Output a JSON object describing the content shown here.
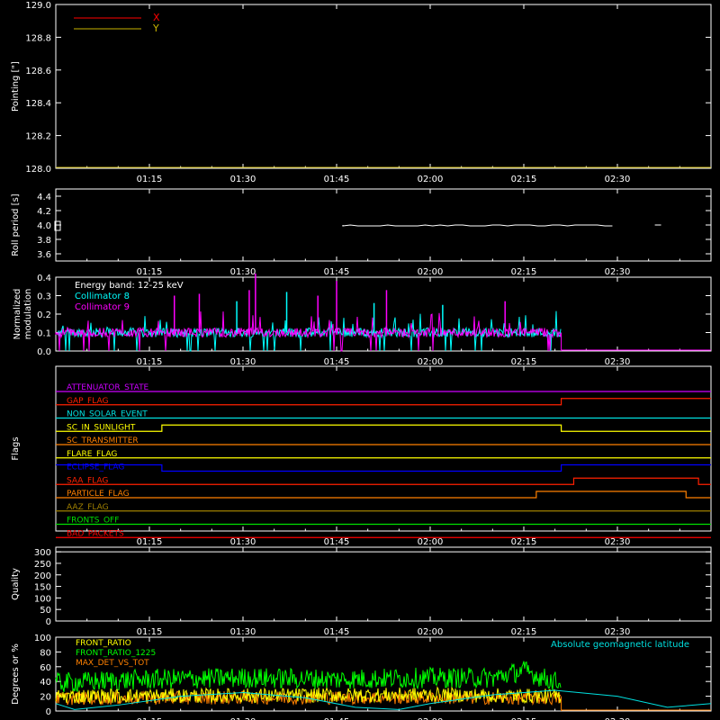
{
  "time_axis": {
    "start": "01:00",
    "end": "02:45",
    "ticks": [
      "01:15",
      "01:30",
      "01:45",
      "02:00",
      "02:15",
      "02:30"
    ]
  },
  "chart_data": [
    {
      "id": "pointing",
      "type": "line",
      "ylabel": "Pointing [\"]",
      "ylim": [
        128.0,
        129.0
      ],
      "yticks": [
        "128.0",
        "128.2",
        "128.4",
        "128.6",
        "128.8",
        "129.0"
      ],
      "legend": [
        {
          "name": "X",
          "color": "#ff0000"
        },
        {
          "name": "Y",
          "color": "#c8b400"
        }
      ],
      "series": []
    },
    {
      "id": "roll",
      "type": "line",
      "ylabel": "Roll period [s]",
      "ylim": [
        3.5,
        4.5
      ],
      "yticks": [
        "3.6",
        "3.8",
        "4.0",
        "4.2",
        "4.4"
      ],
      "series": [
        {
          "color": "#ffffff",
          "x": [
            "01:46",
            "02:02",
            "02:22",
            "02:27",
            "02:36"
          ],
          "values": [
            4.0,
            4.0,
            4.0,
            4.0,
            4.0
          ]
        }
      ]
    },
    {
      "id": "modulation",
      "type": "line",
      "ylabel": "Normalized modulation",
      "ylim": [
        0.0,
        0.4
      ],
      "yticks": [
        "0.0",
        "0.1",
        "0.2",
        "0.3",
        "0.4"
      ],
      "annotation": "Energy band: 12-25 keV",
      "series": [
        {
          "name": "Collimator 8",
          "color": "#00ffff"
        },
        {
          "name": "Collimator 9",
          "color": "#ff00ff"
        }
      ],
      "data_until": "02:21",
      "typical_value": 0.1,
      "spikes": [
        {
          "x": "01:32",
          "y": 0.42,
          "series": 1
        },
        {
          "x": "01:31",
          "y": 0.33,
          "series": 1
        },
        {
          "x": "01:23",
          "y": 0.31,
          "series": 1
        },
        {
          "x": "01:19",
          "y": 0.3,
          "series": 1
        },
        {
          "x": "01:45",
          "y": 0.38,
          "series": 1
        },
        {
          "x": "01:42",
          "y": 0.3,
          "series": 1
        },
        {
          "x": "01:53",
          "y": 0.33,
          "series": 1
        },
        {
          "x": "02:12",
          "y": 0.27,
          "series": 1
        },
        {
          "x": "01:37",
          "y": 0.32,
          "series": 0
        },
        {
          "x": "01:29",
          "y": 0.27,
          "series": 0
        },
        {
          "x": "01:51",
          "y": 0.26,
          "series": 0
        },
        {
          "x": "02:02",
          "y": 0.25,
          "series": 0
        }
      ]
    },
    {
      "id": "flags",
      "type": "line",
      "ylabel": "Flags",
      "flags": [
        {
          "name": "ATTENUATOR_STATE",
          "color": "#cc00ff",
          "steps": [
            [
              "01:00",
              0
            ]
          ]
        },
        {
          "name": "GAP_FLAG",
          "color": "#ff2000",
          "steps": [
            [
              "01:00",
              0
            ],
            [
              "02:21",
              1
            ]
          ]
        },
        {
          "name": "NON_SOLAR_EVENT",
          "color": "#00e0e0",
          "steps": [
            [
              "01:00",
              0
            ]
          ]
        },
        {
          "name": "SC_IN_SUNLIGHT",
          "color": "#ffff00",
          "steps": [
            [
              "01:00",
              0
            ],
            [
              "01:17",
              1
            ],
            [
              "02:21",
              0
            ]
          ]
        },
        {
          "name": "SC_TRANSMITTER",
          "color": "#ff8000",
          "steps": [
            [
              "01:00",
              0
            ]
          ]
        },
        {
          "name": "FLARE_FLAG",
          "color": "#ffff00",
          "steps": [
            [
              "01:00",
              0
            ]
          ]
        },
        {
          "name": "ECLIPSE_FLAG",
          "color": "#0000ff",
          "steps": [
            [
              "01:00",
              1
            ],
            [
              "01:17",
              0
            ],
            [
              "02:21",
              1
            ]
          ]
        },
        {
          "name": "SAA_FLAG",
          "color": "#ff2000",
          "steps": [
            [
              "01:00",
              0
            ],
            [
              "02:23",
              1
            ],
            [
              "02:43",
              0
            ]
          ]
        },
        {
          "name": "PARTICLE_FLAG",
          "color": "#ff8000",
          "steps": [
            [
              "01:00",
              0
            ],
            [
              "02:17",
              1
            ],
            [
              "02:41",
              0
            ]
          ]
        },
        {
          "name": "AAZ_FLAG",
          "color": "#a08000",
          "steps": [
            [
              "01:00",
              0
            ]
          ]
        },
        {
          "name": "FRONTS_OFF",
          "color": "#00e000",
          "steps": [
            [
              "01:00",
              0
            ]
          ]
        },
        {
          "name": "BAD_PACKETS",
          "color": "#ff0000",
          "steps": [
            [
              "01:00",
              0
            ]
          ]
        }
      ]
    },
    {
      "id": "quality",
      "type": "line",
      "ylabel": "Quality",
      "ylim": [
        0,
        320
      ],
      "yticks": [
        "0",
        "50",
        "100",
        "150",
        "200",
        "250",
        "300"
      ],
      "series": [
        {
          "color": "#ffffff",
          "x": [
            "01:00",
            "02:45"
          ],
          "values": [
            300,
            300
          ]
        }
      ]
    },
    {
      "id": "ratios",
      "type": "line",
      "ylabel": "Degrees or %",
      "ylim": [
        0,
        100
      ],
      "yticks": [
        "0",
        "20",
        "40",
        "60",
        "80",
        "100"
      ],
      "annotation": "Absolute geomagnetic latitude",
      "data_until": "02:21",
      "series": [
        {
          "name": "FRONT_RATIO",
          "color": "#ffff00",
          "x": [
            "01:00",
            "01:30",
            "02:00",
            "02:21"
          ],
          "values": [
            20,
            21,
            22,
            20
          ]
        },
        {
          "name": "FRONT_RATIO_1225",
          "color": "#00ff00",
          "x": [
            "01:00",
            "01:15",
            "01:30",
            "01:45",
            "02:00",
            "02:10",
            "02:15",
            "02:18",
            "02:21"
          ],
          "values": [
            38,
            43,
            45,
            43,
            45,
            45,
            55,
            45,
            38
          ]
        },
        {
          "name": "MAX_DET_VS_TOT",
          "color": "#ff8000",
          "x": [
            "01:00",
            "01:30",
            "02:00",
            "02:21"
          ],
          "values": [
            17,
            18,
            18,
            17
          ]
        },
        {
          "name": "Absolute geomagnetic latitude",
          "color": "#00e0e0",
          "x": [
            "01:00",
            "01:03",
            "01:10",
            "01:20",
            "01:30",
            "01:40",
            "01:48",
            "01:55",
            "02:00",
            "02:10",
            "02:20",
            "02:30",
            "02:38",
            "02:45"
          ],
          "values": [
            10,
            2,
            8,
            20,
            25,
            18,
            5,
            2,
            10,
            22,
            28,
            20,
            5,
            10
          ]
        }
      ]
    }
  ]
}
